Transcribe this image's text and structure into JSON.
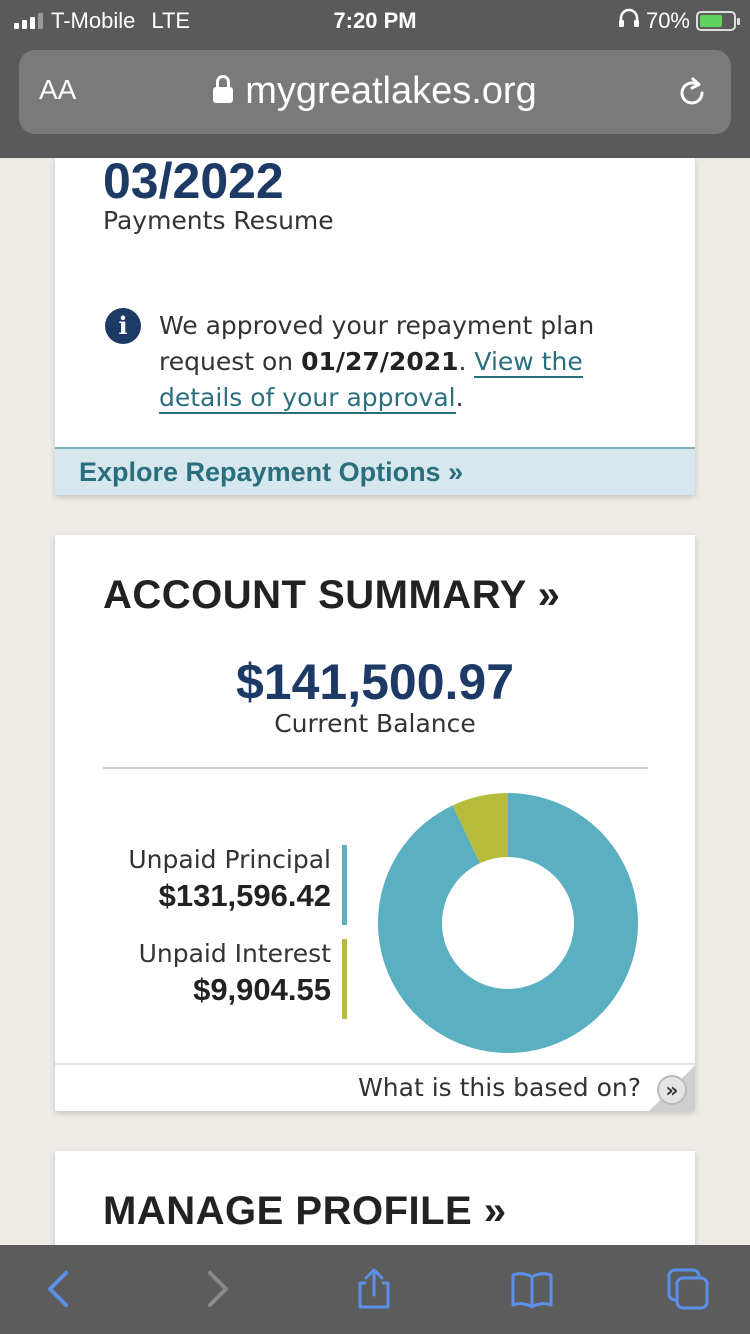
{
  "status_bar": {
    "carrier": "T-Mobile",
    "network": "LTE",
    "time": "7:20 PM",
    "battery_percent": "70%",
    "battery_level": 0.7
  },
  "url_bar": {
    "text_size_label": "AA",
    "domain": "mygreatlakes.org"
  },
  "plan_card": {
    "resume_date": "03/2022",
    "resume_label": "Payments Resume",
    "info_prefix": "We approved your repayment plan request on ",
    "approval_date": "01/27/2021",
    "info_separator": ". ",
    "details_link": "View the details of your approval",
    "info_suffix": ".",
    "explore_link": "Explore Repayment Options »"
  },
  "account_summary": {
    "title": "ACCOUNT SUMMARY »",
    "balance": "$141,500.97",
    "balance_label": "Current Balance",
    "principal_label": "Unpaid Principal",
    "principal_value": "$131,596.42",
    "interest_label": "Unpaid Interest",
    "interest_value": "$9,904.55",
    "based_on_text": "What is this based on?",
    "based_on_button": "»"
  },
  "manage_profile": {
    "title": "MANAGE PROFILE »"
  },
  "colors": {
    "navy": "#1d3a66",
    "teal": "#5aafc1",
    "olive": "#b5bc3b",
    "link": "#2a6f7e"
  },
  "icons": {
    "info": "i",
    "back": "chevron-left-icon",
    "forward": "chevron-right-icon",
    "share": "share-icon",
    "bookmarks": "book-icon",
    "tabs": "tabs-icon"
  },
  "chart_data": {
    "type": "pie",
    "categories": [
      "Unpaid Principal",
      "Unpaid Interest"
    ],
    "values": [
      131596.42,
      9904.55
    ]
  }
}
